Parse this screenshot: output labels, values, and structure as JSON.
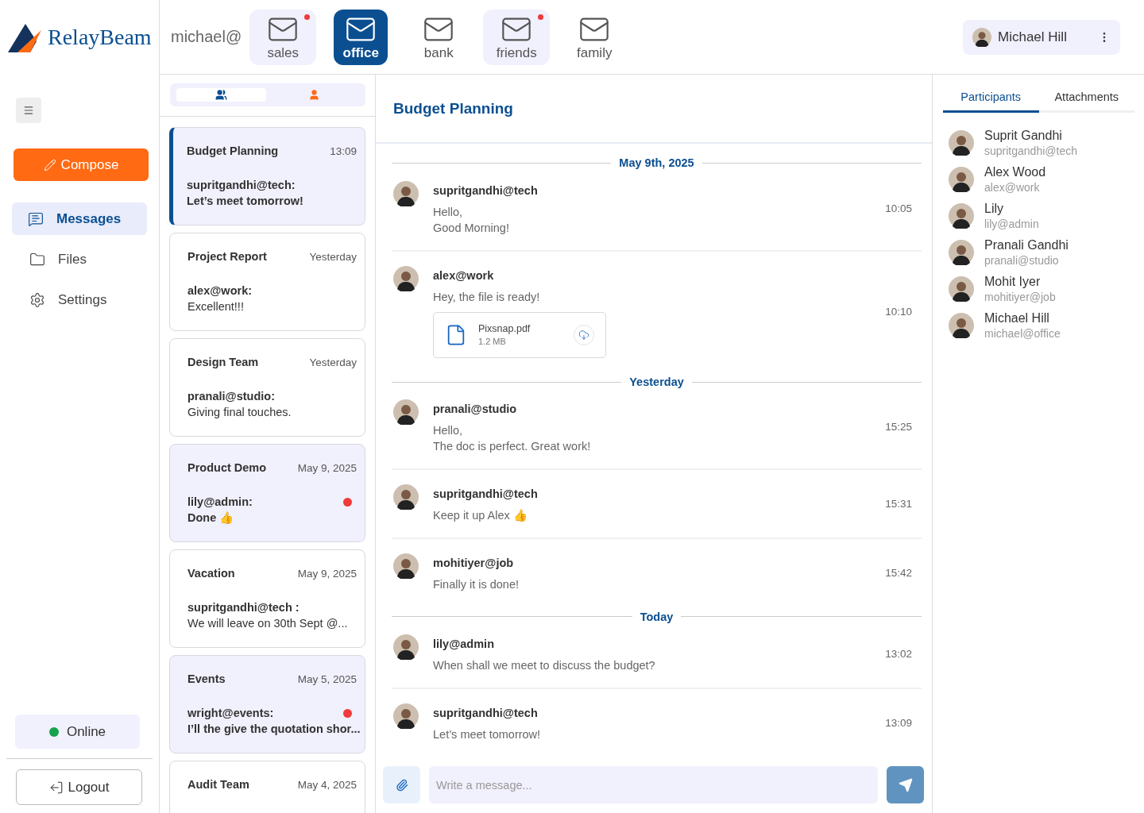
{
  "brand": {
    "name": "RelayBeam"
  },
  "sidebar": {
    "compose": "Compose",
    "nav": [
      {
        "kind": "messages",
        "label": "Messages",
        "selected": true
      },
      {
        "kind": "files",
        "label": "Files",
        "selected": false
      },
      {
        "kind": "settings",
        "label": "Settings",
        "selected": false
      }
    ],
    "status": {
      "label": "Online",
      "color": "#16a34a"
    },
    "logout": "Logout"
  },
  "mailboxes": {
    "prefix": "michael@",
    "items": [
      {
        "label": "sales",
        "selected": false,
        "unread": true
      },
      {
        "label": "office",
        "selected": true,
        "unread": false
      },
      {
        "label": "bank",
        "selected": false,
        "unread": false
      },
      {
        "label": "friends",
        "selected": false,
        "unread": true
      },
      {
        "label": "family",
        "selected": false,
        "unread": false
      }
    ]
  },
  "user": {
    "name": "Michael Hill"
  },
  "list_tabs": [
    {
      "kind": "group",
      "selected": true
    },
    {
      "kind": "person",
      "selected": false
    }
  ],
  "conversations": [
    {
      "title": "Budget Planning",
      "time": "13:09",
      "sender": "supritgandhi@tech:",
      "preview": "Let’s meet tomorrow!",
      "selected": true,
      "unread": false
    },
    {
      "title": "Project Report",
      "time": "Yesterday",
      "sender": "alex@work:",
      "preview": "Excellent!!!",
      "selected": false,
      "unread": false
    },
    {
      "title": "Design Team",
      "time": "Yesterday",
      "sender": "pranali@studio:",
      "preview": "Giving final touches.",
      "selected": false,
      "unread": false
    },
    {
      "title": "Product Demo",
      "time": "May 9, 2025",
      "sender": "lily@admin:",
      "preview": "Done 👍",
      "selected": false,
      "unread": true
    },
    {
      "title": "Vacation",
      "time": "May 9, 2025",
      "sender": "supritgandhi@tech :",
      "preview": "We will leave on 30th Sept @...",
      "selected": false,
      "unread": false
    },
    {
      "title": "Events",
      "time": "May 5, 2025",
      "sender": "wright@events:",
      "preview": "I’ll the give the quotation shor...",
      "selected": false,
      "unread": true
    },
    {
      "title": "Audit Team",
      "time": "May 4, 2025",
      "selected": false,
      "unread": false
    }
  ],
  "chat": {
    "title": "Budget Planning",
    "items": [
      {
        "kind": "divider",
        "label": "May 9th, 2025"
      },
      {
        "kind": "message",
        "author": "supritgandhi@tech",
        "lines": [
          "Hello,",
          "Good Morning!"
        ],
        "time": "10:05"
      },
      {
        "kind": "message",
        "author": "alex@work",
        "lines": [
          "Hey, the file is ready!"
        ],
        "time": "10:10",
        "attachment": {
          "name": "Pixsnap.pdf",
          "size": "1.2 MB"
        }
      },
      {
        "kind": "divider",
        "label": "Yesterday"
      },
      {
        "kind": "message",
        "author": "pranali@studio",
        "lines": [
          "Hello,",
          "The doc is perfect. Great work!"
        ],
        "time": "15:25"
      },
      {
        "kind": "message",
        "author": "supritgandhi@tech",
        "lines": [
          "Keep it up Alex 👍"
        ],
        "time": "15:31"
      },
      {
        "kind": "message",
        "author": "mohitiyer@job",
        "lines": [
          "Finally it is done!"
        ],
        "time": "15:42"
      },
      {
        "kind": "divider",
        "label": "Today"
      },
      {
        "kind": "message",
        "author": "lily@admin",
        "lines": [
          "When shall we meet to discuss the budget?"
        ],
        "time": "13:02"
      },
      {
        "kind": "message",
        "author": "supritgandhi@tech",
        "lines": [
          "Let’s meet tomorrow!"
        ],
        "time": "13:09"
      }
    ],
    "composer": {
      "placeholder": "Write a message..."
    }
  },
  "details": {
    "tabs": [
      {
        "label": "Participants",
        "selected": true
      },
      {
        "label": "Attachments",
        "selected": false
      }
    ],
    "participants": [
      {
        "name": "Suprit Gandhi",
        "handle": "supritgandhi@tech"
      },
      {
        "name": "Alex Wood",
        "handle": "alex@work"
      },
      {
        "name": "Lily",
        "handle": "lily@admin"
      },
      {
        "name": "Pranali Gandhi",
        "handle": "pranali@studio"
      },
      {
        "name": "Mohit Iyer",
        "handle": "mohitiyer@job"
      },
      {
        "name": "Michael Hill",
        "handle": "michael@office"
      }
    ]
  }
}
